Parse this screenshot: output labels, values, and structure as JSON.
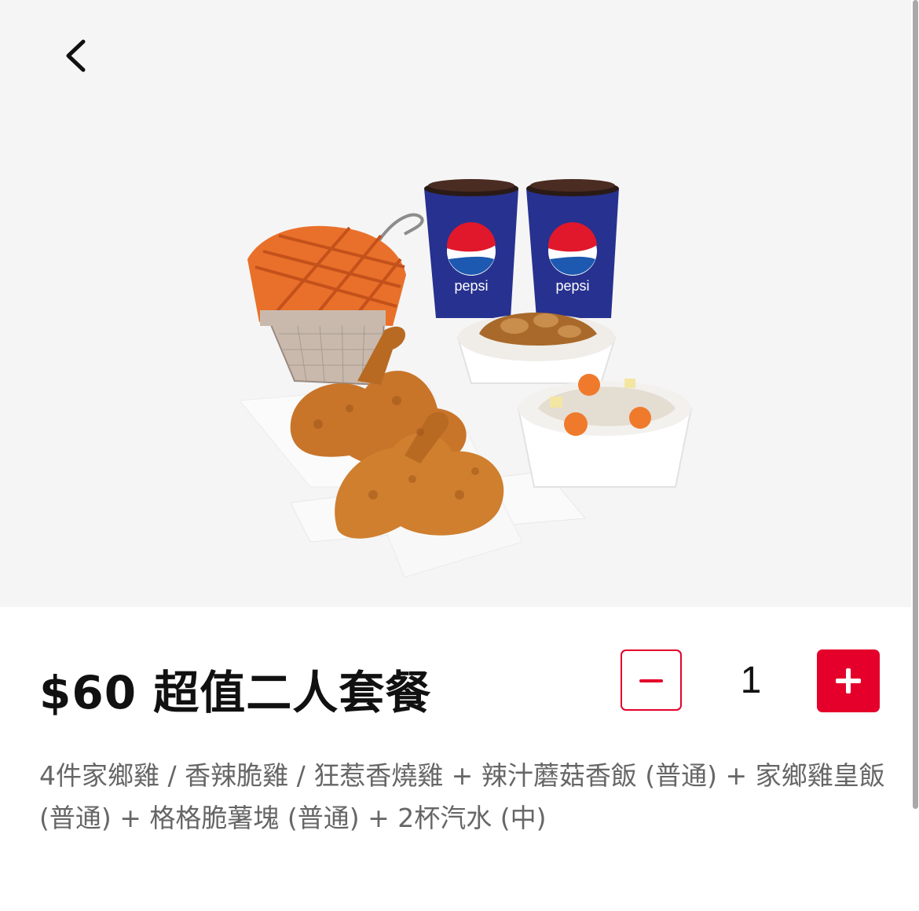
{
  "product": {
    "title": "$60 超值二人套餐",
    "description": "4件家鄉雞 / 香辣脆雞 / 狂惹香燒雞 + 辣汁蘑菇香飯 (普通) + 家鄉雞皇飯 (普通) + 格格脆薯塊 (普通) + 2杯汽水 (中)",
    "image_cup_text": "pepsi"
  },
  "quantity": {
    "value": "1"
  },
  "icons": {
    "back": "chevron-left-icon",
    "decrease": "minus-icon",
    "increase": "plus-icon"
  },
  "colors": {
    "accent": "#e4002b",
    "hero_background": "#f5f5f5",
    "title_text": "#111111",
    "description_text": "#666666"
  }
}
